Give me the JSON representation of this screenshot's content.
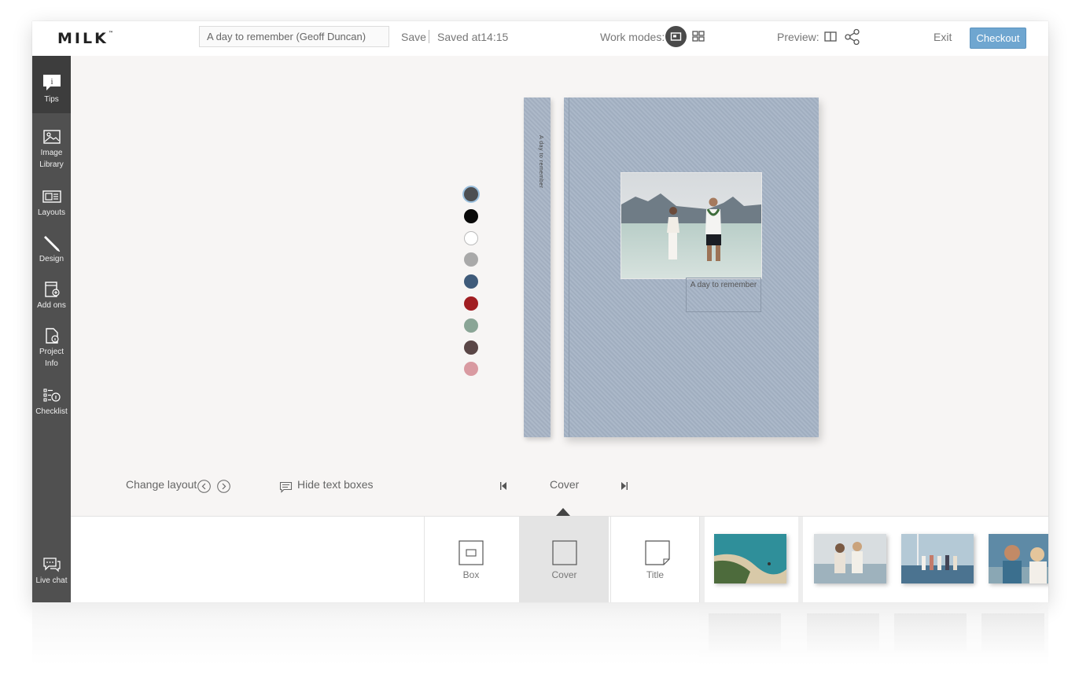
{
  "header": {
    "logo": "MILK",
    "logo_tm": "™",
    "project_title": "A day to remember (Geoff Duncan)",
    "save_label": "Save",
    "saved_status": "Saved at14:15",
    "work_modes_label": "Work modes:",
    "work_modes": [
      {
        "name": "single-page",
        "icon": "single-page-icon",
        "active": true
      },
      {
        "name": "grid",
        "icon": "grid-icon",
        "active": false
      }
    ],
    "preview_label": "Preview:",
    "exit_label": "Exit",
    "checkout_label": "Checkout",
    "checkout_color": "#6fa6d0"
  },
  "sidebar": {
    "items": [
      {
        "label": "Tips",
        "icon": "tips-icon",
        "active": true
      },
      {
        "label": "Image Library",
        "icon": "image-icon",
        "active": false
      },
      {
        "label": "Layouts",
        "icon": "layouts-icon",
        "active": false
      },
      {
        "label": "Design",
        "icon": "pencil-icon",
        "active": false
      },
      {
        "label": "Add ons",
        "icon": "add-ons-icon",
        "active": false
      },
      {
        "label": "Project Info",
        "icon": "project-info-icon",
        "active": false
      },
      {
        "label": "Checklist",
        "icon": "checklist-icon",
        "active": false
      }
    ],
    "live_chat_label": "Live chat"
  },
  "canvas": {
    "swatches": [
      "#4d4f52",
      "#0a0a0a",
      "#ffffff",
      "#a9a9a9",
      "#3f5b7a",
      "#a11e22",
      "#8aa596",
      "#5a4646",
      "#d99aa1"
    ],
    "selected_swatch": 0,
    "spine_text": "A day to remember",
    "cover_title": "A day to remember",
    "cover_color": "#a5b3c5",
    "change_layout_label": "Change layout",
    "hide_text_boxes_label": "Hide text boxes",
    "page_label": "Cover"
  },
  "tray": {
    "layouts": [
      {
        "label": "Box",
        "active": false
      },
      {
        "label": "Cover",
        "active": true
      },
      {
        "label": "Title",
        "active": false
      }
    ]
  }
}
